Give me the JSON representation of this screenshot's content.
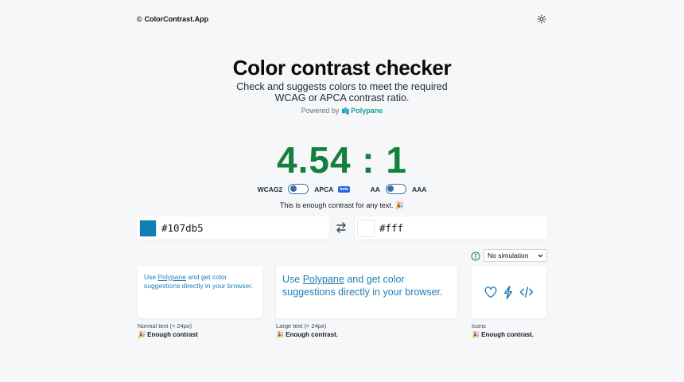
{
  "header": {
    "brand": "ColorContrast.App",
    "theme_icon": "sun-icon"
  },
  "hero": {
    "title": "Color contrast checker",
    "subtitle_line1": "Check and suggests colors to meet the required",
    "subtitle_line2": "WCAG or APCA contrast ratio.",
    "powered_by": "Powered by",
    "powered_link": "Polypane"
  },
  "ratio": "4.54 : 1",
  "switches": {
    "algo_left": "WCAG2",
    "algo_right": "APCA",
    "algo_badge": "beta",
    "level_left": "AA",
    "level_right": "AAA"
  },
  "status_message": "This is enough contrast for any text. 🎉",
  "foreground": {
    "hex": "#107db5",
    "color": "#107db5"
  },
  "background": {
    "hex": "#fff",
    "color": "#ffffff"
  },
  "simulation": {
    "selected": "No simulation"
  },
  "preview": {
    "text_before": "Use ",
    "link": "Polypane",
    "text_after": " and get color suggestions directly in your browser.",
    "normal_label": "Normal text (< 24px)",
    "normal_result": "🎉 Enough contrast",
    "large_label": "Large text (> 24px)",
    "large_result": "🎉 Enough contrast.",
    "icons_label": "Icons",
    "icons_result": "🎉 Enough contrast.",
    "icons": [
      "heart-icon",
      "lightning-icon",
      "code-icon"
    ]
  }
}
